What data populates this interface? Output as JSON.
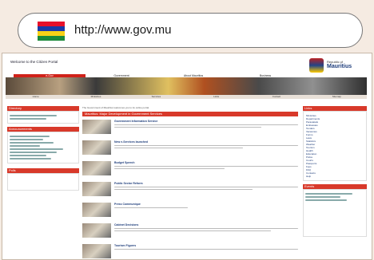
{
  "browser": {
    "url": "http://www.gov.mu",
    "flag_colors": [
      "#e8102a",
      "#1a3aa8",
      "#f7d117",
      "#1a8a3a"
    ]
  },
  "site": {
    "welcome": "Welcome to the Citizen Portal",
    "republic": "Republic of",
    "country": "Mauritius",
    "nav_tabs": [
      "e-Gov",
      "Government",
      "About Mauritius",
      "Business"
    ],
    "banner_menu": [
      "Home",
      "Ministries",
      "Services",
      "Links",
      "Contact",
      "Sitemap"
    ],
    "left_box_title": "Directory",
    "left_box2_title": "Announcements",
    "left_box3_title": "Polls",
    "main_intro": "The Government of Mauritius welcomes you to its online portal.",
    "main_heading": "Mauritius: Major Development in Government Services",
    "news": [
      {
        "title": "Government Information Service"
      },
      {
        "title": "New e-Services launched"
      },
      {
        "title": "Budget Speech"
      },
      {
        "title": "Public Sector Reform"
      },
      {
        "title": "Press Communique"
      },
      {
        "title": "Cabinet Decisions"
      },
      {
        "title": "Tourism Figures"
      }
    ],
    "right_title": "Links",
    "right_links": [
      "Ministries",
      "Departments",
      "Parastatals",
      "Embassies",
      "Tenders",
      "Vacancies",
      "Forms",
      "Laws",
      "Statistics",
      "Weather",
      "Tourism",
      "Health",
      "Education",
      "Police",
      "Courts",
      "Passports",
      "Fees",
      "FAQ",
      "Contacts",
      "Help"
    ],
    "right_box2_title": "Events"
  }
}
